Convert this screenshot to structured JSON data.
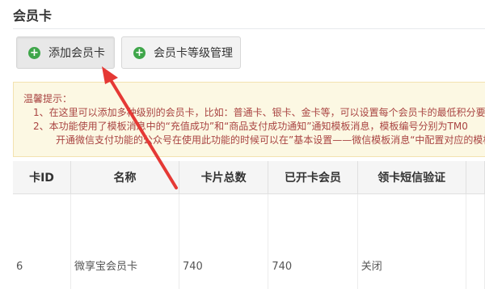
{
  "page": {
    "title": "会员卡"
  },
  "toolbar": {
    "add_label": "添加会员卡",
    "level_label": "会员卡等级管理"
  },
  "tips": {
    "heading": "温馨提示：",
    "lines": [
      "1、在这里可以添加多种级别的会员卡，比如：普通卡、银卡、金卡等，可以设置每个会员卡的最低积分要求",
      "2、本功能使用了模板消息中的“充值成功”和“商品支付成功通知”通知模板消息，模板编号分别为TM0",
      "开通微信支付功能的公众号在使用此功能的时候可以在”基本设置——微信模板消息“中配置对应的模板"
    ]
  },
  "table": {
    "headers": [
      "卡ID",
      "名称",
      "卡片总数",
      "已开卡会员",
      "领卡短信验证",
      ""
    ],
    "rows": [
      [
        "6",
        "微享宝会员卡",
        "740",
        "740",
        "关闭",
        ""
      ]
    ]
  },
  "colors": {
    "accent_green": "#3fa64a",
    "tip_text": "#a94442",
    "tip_bg": "#fcf8e3",
    "arrow_red": "#e53935"
  }
}
